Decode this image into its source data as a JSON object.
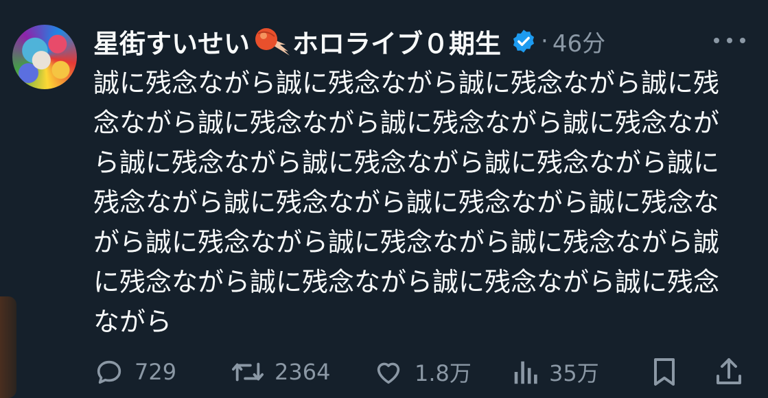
{
  "tweet": {
    "display_name": "星街すいせい",
    "name_suffix": "ホロライブ０期生",
    "separator": "·",
    "timestamp": "46分",
    "text": "誠に残念ながら誠に残念ながら誠に残念ながら誠に残念ながら誠に残念ながら誠に残念ながら誠に残念ながら誠に残念ながら誠に残念ながら誠に残念ながら誠に残念ながら誠に残念ながら誠に残念ながら誠に残念ながら誠に残念ながら誠に残念ながら誠に残念ながら誠に残念ながら誠に残念ながら誠に残念ながら誠に残念ながら"
  },
  "actions": {
    "replies": "729",
    "reposts": "2364",
    "likes": "1.8万",
    "views": "35万"
  },
  "icons": {
    "verified": "verified-badge-icon",
    "more": "more-icon",
    "reply": "reply-icon",
    "repost": "repost-icon",
    "like": "like-icon",
    "views": "views-icon",
    "bookmark": "bookmark-icon",
    "share": "share-icon"
  },
  "colors": {
    "background": "#15202b",
    "text": "#f7f9f9",
    "muted": "#8b98a5",
    "verified": "#1d9bf0"
  }
}
